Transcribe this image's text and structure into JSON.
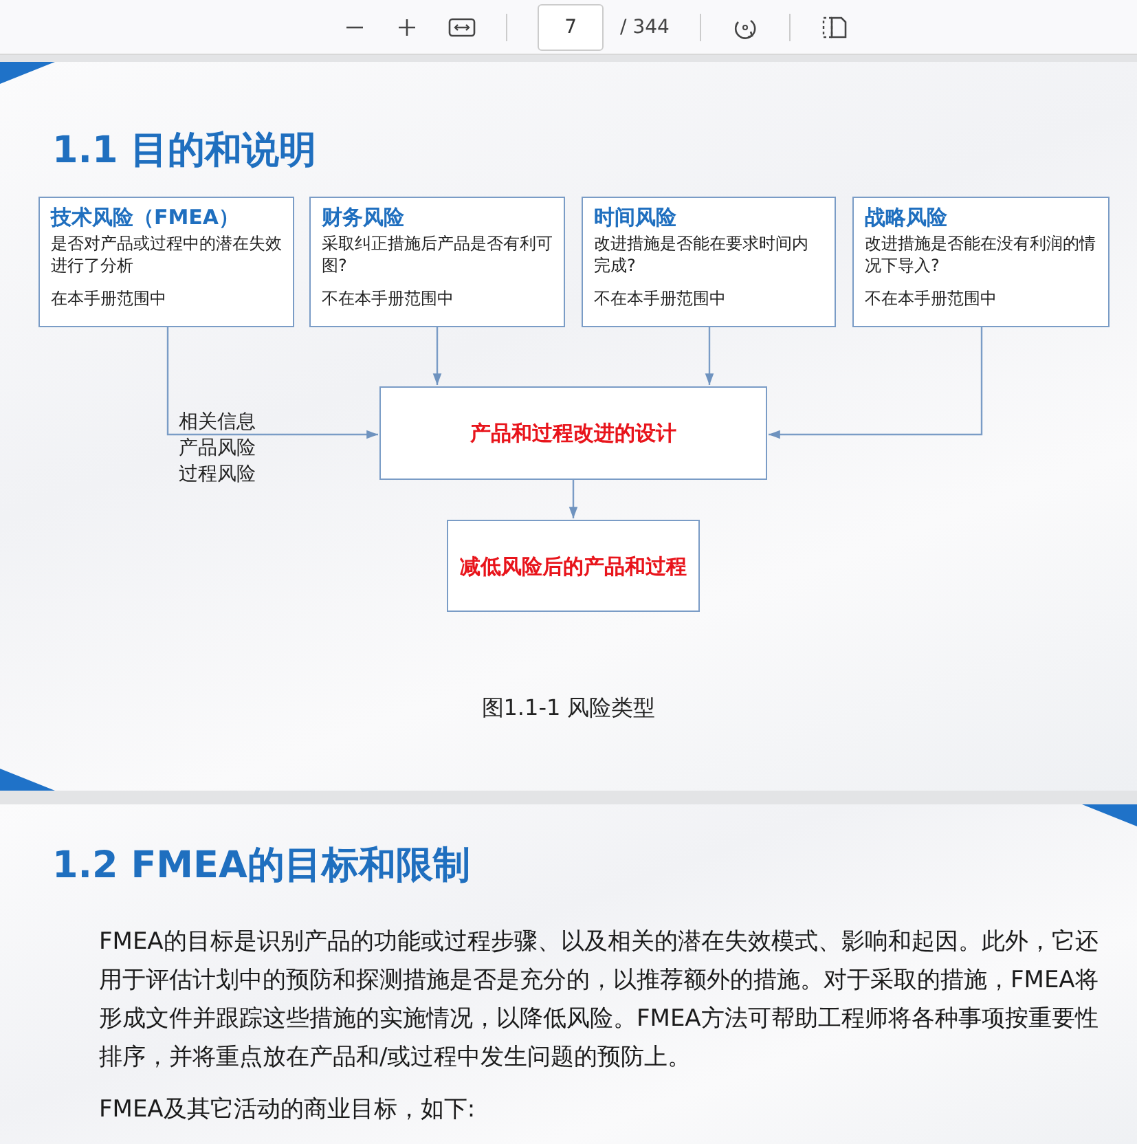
{
  "toolbar": {
    "page_number": "7",
    "page_total": "/ 344"
  },
  "section_1": {
    "heading": "1.1 目的和说明",
    "risk_boxes": [
      {
        "title": "技术风险（FMEA）",
        "description": "是否对产品或过程中的潜在失效进行了分析",
        "scope": "在本手册范围中"
      },
      {
        "title": "财务风险",
        "description": "采取纠正措施后产品是否有利可图?",
        "scope": "不在本手册范围中"
      },
      {
        "title": "时间风险",
        "description": "改进措施是否能在要求时间内完成?",
        "scope": "不在本手册范围中"
      },
      {
        "title": "战略风险",
        "description": "改进措施是否能在没有利润的情况下导入?",
        "scope": "不在本手册范围中"
      }
    ],
    "related_info": [
      "相关信息",
      "产品风险",
      "过程风险"
    ],
    "design_box": "产品和过程改进的设计",
    "result_box": "减低风险后的产品和过程",
    "caption": "图1.1-1 风险类型"
  },
  "section_2": {
    "heading": "1.2 FMEA的目标和限制",
    "paragraphs": [
      "FMEA的目标是识别产品的功能或过程步骤、以及相关的潜在失效模式、影响和起因。此外，它还用于评估计划中的预防和探测措施是否是充分的，以推荐额外的措施。对于采取的措施，FMEA将形成文件并跟踪这些措施的实施情况，以降低风险。FMEA方法可帮助工程师将各种事项按重要性排序，并将重点放在产品和/或过程中发生问题的预防上。",
      "FMEA及其它活动的商业目标，如下:"
    ]
  }
}
